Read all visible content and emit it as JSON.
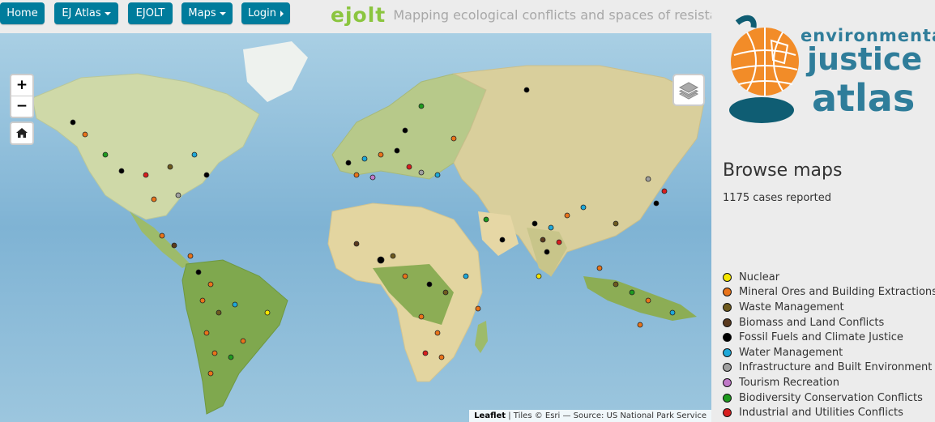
{
  "nav": {
    "home": "Home",
    "ej_atlas": "EJ Atlas",
    "ejolt": "EJOLT",
    "maps": "Maps",
    "login": "Login"
  },
  "brand": {
    "logo_text": "ejolt",
    "tagline": "Mapping ecological conflicts and spaces of resistance"
  },
  "map": {
    "zoom_in": "+",
    "zoom_out": "−",
    "attribution_lib": "Leaflet",
    "attribution_text": " | Tiles © Esri — Source: US National Park Service"
  },
  "panel": {
    "logo_line1": "environmental",
    "logo_line2": "justice",
    "logo_line3": "atlas",
    "browse_title": "Browse maps",
    "cases_reported": "1175 cases reported"
  },
  "legend": [
    {
      "label": "Nuclear",
      "color": "#f5e600"
    },
    {
      "label": "Mineral Ores and Building Extractions",
      "color": "#e8731a"
    },
    {
      "label": "Waste Management",
      "color": "#6e5a1e"
    },
    {
      "label": "Biomass and Land Conflicts",
      "color": "#5a3a1e"
    },
    {
      "label": "Fossil Fuels and Climate Justice",
      "color": "#000000"
    },
    {
      "label": "Water Management",
      "color": "#1ea8d8"
    },
    {
      "label": "Infrastructure and Built Environment",
      "color": "#a0a0a0"
    },
    {
      "label": "Tourism Recreation",
      "color": "#c078c8"
    },
    {
      "label": "Biodiversity Conservation Conflicts",
      "color": "#1e9a1e"
    },
    {
      "label": "Industrial and Utilities Conflicts",
      "color": "#d81e1e"
    }
  ]
}
